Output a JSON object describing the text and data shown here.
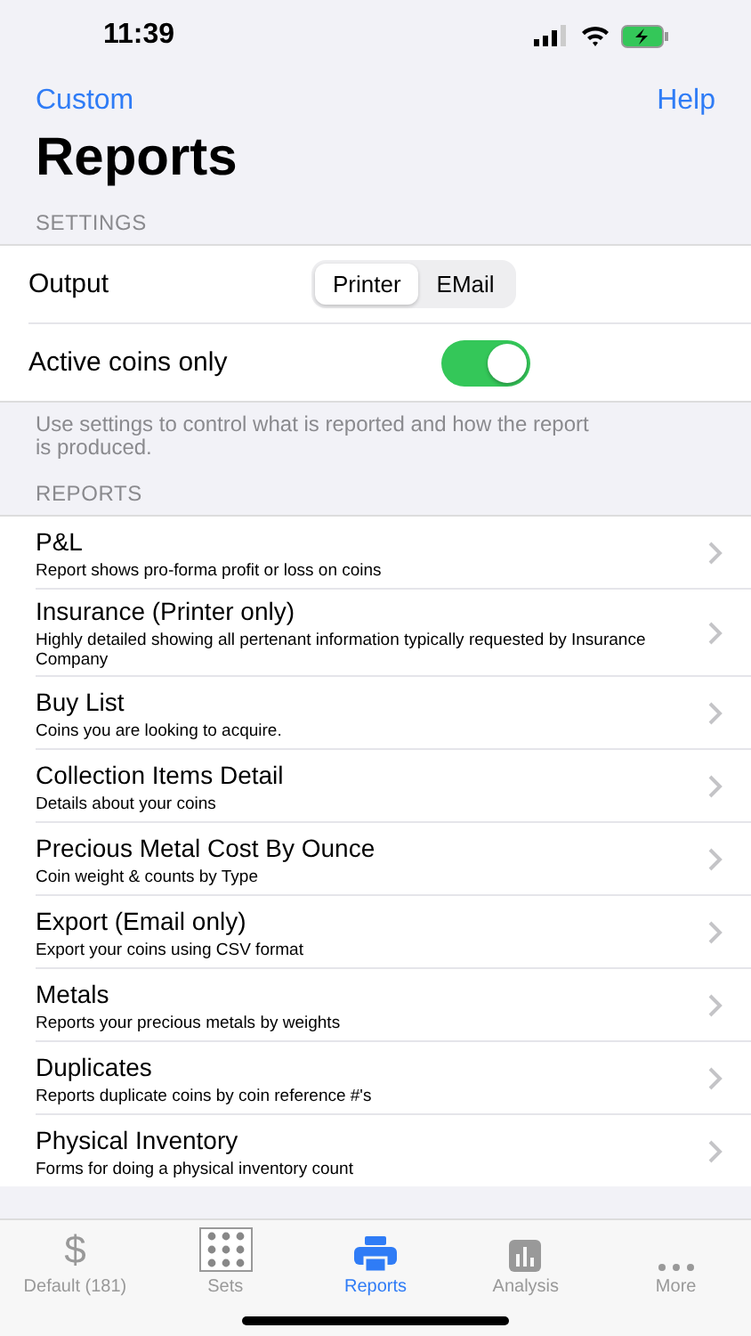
{
  "status_bar": {
    "time": "11:39"
  },
  "nav": {
    "left": "Custom",
    "right": "Help"
  },
  "title": "Reports",
  "settings": {
    "header": "SETTINGS",
    "output_label": "Output",
    "output_options": [
      {
        "label": "Printer",
        "selected": true
      },
      {
        "label": "EMail",
        "selected": false
      }
    ],
    "active_label": "Active coins only",
    "active_on": true,
    "footer": "Use settings to control what is reported and how the report is produced."
  },
  "reports": {
    "header": "REPORTS",
    "items": [
      {
        "title": "P&L",
        "subtitle": "Report shows pro-forma profit or loss on coins"
      },
      {
        "title": "Insurance (Printer only)",
        "subtitle": "Highly detailed showing all pertenant information typically requested by Insurance Company"
      },
      {
        "title": "Buy List",
        "subtitle": "Coins you are looking to acquire."
      },
      {
        "title": "Collection Items Detail",
        "subtitle": "Details about your coins"
      },
      {
        "title": "Precious Metal Cost By Ounce",
        "subtitle": "Coin weight & counts by Type"
      },
      {
        "title": "Export (Email only)",
        "subtitle": "Export your coins using CSV format"
      },
      {
        "title": "Metals",
        "subtitle": "Reports your precious metals by weights"
      },
      {
        "title": "Duplicates",
        "subtitle": "Reports duplicate coins by coin reference #'s"
      },
      {
        "title": "Physical Inventory",
        "subtitle": "Forms for doing a physical inventory count"
      }
    ]
  },
  "tab_bar": [
    {
      "kind": "dollar",
      "icon": "$",
      "label": "Default (181)",
      "selected": false
    },
    {
      "kind": "grid",
      "label": "Sets",
      "selected": false
    },
    {
      "kind": "printer",
      "label": "Reports",
      "selected": true
    },
    {
      "kind": "chart",
      "label": "Analysis",
      "selected": false
    },
    {
      "kind": "more",
      "label": "More",
      "selected": false
    }
  ]
}
